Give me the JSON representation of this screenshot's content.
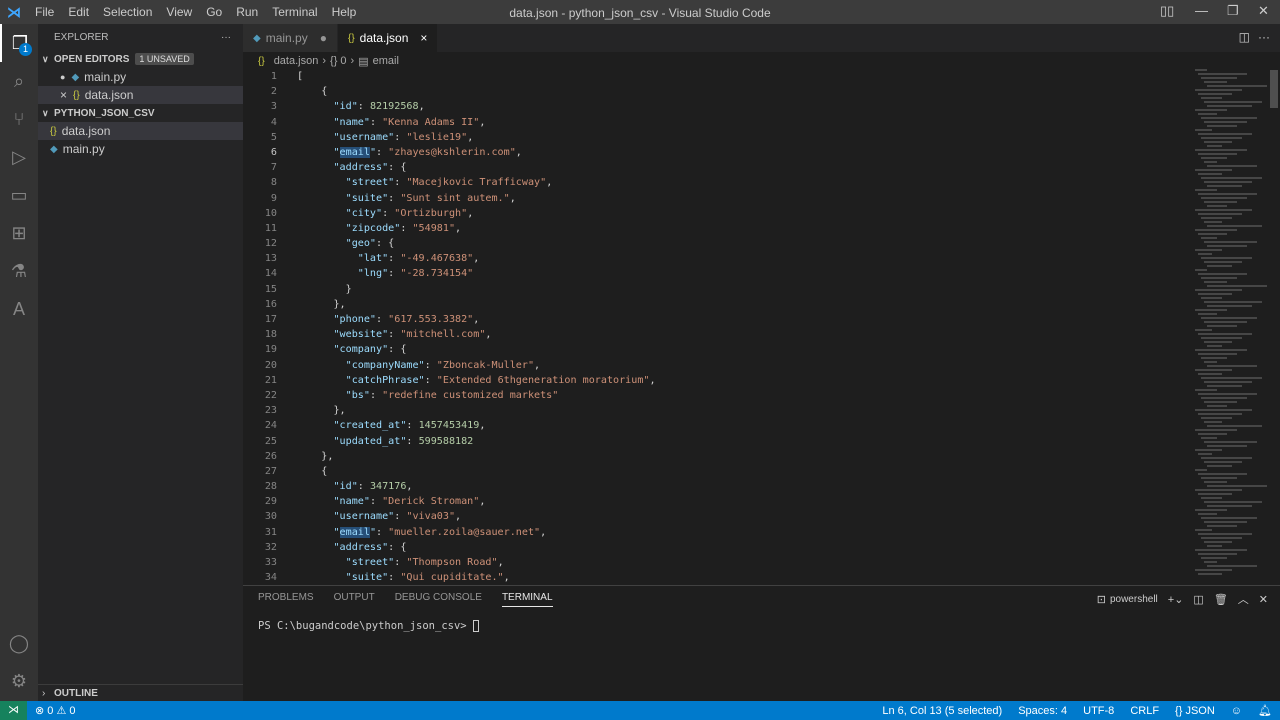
{
  "titlebar": {
    "menu": [
      "File",
      "Edit",
      "Selection",
      "View",
      "Go",
      "Run",
      "Terminal",
      "Help"
    ],
    "title": "data.json - python_json_csv - Visual Studio Code"
  },
  "activity": {
    "explorer_badge": "1"
  },
  "sidebar": {
    "header": "EXPLORER",
    "more": "···",
    "open_editors": "OPEN EDITORS",
    "unsaved": "1 UNSAVED",
    "open_items": [
      {
        "label": "main.py",
        "icon": "python-icon",
        "marker": "●"
      },
      {
        "label": "data.json",
        "icon": "json-icon",
        "marker": "×"
      }
    ],
    "folder": "PYTHON_JSON_CSV",
    "files": [
      {
        "label": "data.json",
        "icon": "json-icon"
      },
      {
        "label": "main.py",
        "icon": "python-icon"
      }
    ],
    "outline": "OUTLINE"
  },
  "tabs": [
    {
      "label": "main.py",
      "icon": "{}",
      "state": "●"
    },
    {
      "label": "data.json",
      "icon": "{}",
      "state": "×"
    }
  ],
  "breadcrumb": [
    "data.json",
    "{} 0",
    "email"
  ],
  "editor": {
    "current_line": 6,
    "lines": [
      [
        [
          "p",
          "["
        ]
      ],
      [
        [
          "p",
          "    {"
        ]
      ],
      [
        [
          "p",
          "      "
        ],
        [
          "k",
          "\"id\""
        ],
        [
          "p",
          ": "
        ],
        [
          "n",
          "82192568"
        ],
        [
          "p",
          ","
        ]
      ],
      [
        [
          "p",
          "      "
        ],
        [
          "k",
          "\"name\""
        ],
        [
          "p",
          ": "
        ],
        [
          "s",
          "\"Kenna Adams II\""
        ],
        [
          "p",
          ","
        ]
      ],
      [
        [
          "p",
          "      "
        ],
        [
          "k",
          "\"username\""
        ],
        [
          "p",
          ": "
        ],
        [
          "s",
          "\"leslie19\""
        ],
        [
          "p",
          ","
        ]
      ],
      [
        [
          "p",
          "      "
        ],
        [
          "k",
          "\""
        ],
        [
          "k hl",
          "email"
        ],
        [
          "k",
          "\""
        ],
        [
          "p",
          ": "
        ],
        [
          "s",
          "\"zhayes@kshlerin.com\""
        ],
        [
          "p",
          ","
        ]
      ],
      [
        [
          "p",
          "      "
        ],
        [
          "k",
          "\"address\""
        ],
        [
          "p",
          ": {"
        ]
      ],
      [
        [
          "p",
          "        "
        ],
        [
          "k",
          "\"street\""
        ],
        [
          "p",
          ": "
        ],
        [
          "s",
          "\"Macejkovic Trafficway\""
        ],
        [
          "p",
          ","
        ]
      ],
      [
        [
          "p",
          "        "
        ],
        [
          "k",
          "\"suite\""
        ],
        [
          "p",
          ": "
        ],
        [
          "s",
          "\"Sunt sint autem.\""
        ],
        [
          "p",
          ","
        ]
      ],
      [
        [
          "p",
          "        "
        ],
        [
          "k",
          "\"city\""
        ],
        [
          "p",
          ": "
        ],
        [
          "s",
          "\"Ortizburgh\""
        ],
        [
          "p",
          ","
        ]
      ],
      [
        [
          "p",
          "        "
        ],
        [
          "k",
          "\"zipcode\""
        ],
        [
          "p",
          ": "
        ],
        [
          "s",
          "\"54981\""
        ],
        [
          "p",
          ","
        ]
      ],
      [
        [
          "p",
          "        "
        ],
        [
          "k",
          "\"geo\""
        ],
        [
          "p",
          ": {"
        ]
      ],
      [
        [
          "p",
          "          "
        ],
        [
          "k",
          "\"lat\""
        ],
        [
          "p",
          ": "
        ],
        [
          "s",
          "\"-49.467638\""
        ],
        [
          "p",
          ","
        ]
      ],
      [
        [
          "p",
          "          "
        ],
        [
          "k",
          "\"lng\""
        ],
        [
          "p",
          ": "
        ],
        [
          "s",
          "\"-28.734154\""
        ]
      ],
      [
        [
          "p",
          "        }"
        ]
      ],
      [
        [
          "p",
          "      },"
        ]
      ],
      [
        [
          "p",
          "      "
        ],
        [
          "k",
          "\"phone\""
        ],
        [
          "p",
          ": "
        ],
        [
          "s",
          "\"617.553.3382\""
        ],
        [
          "p",
          ","
        ]
      ],
      [
        [
          "p",
          "      "
        ],
        [
          "k",
          "\"website\""
        ],
        [
          "p",
          ": "
        ],
        [
          "s",
          "\"mitchell.com\""
        ],
        [
          "p",
          ","
        ]
      ],
      [
        [
          "p",
          "      "
        ],
        [
          "k",
          "\"company\""
        ],
        [
          "p",
          ": {"
        ]
      ],
      [
        [
          "p",
          "        "
        ],
        [
          "k",
          "\"companyName\""
        ],
        [
          "p",
          ": "
        ],
        [
          "s",
          "\"Zboncak-Muller\""
        ],
        [
          "p",
          ","
        ]
      ],
      [
        [
          "p",
          "        "
        ],
        [
          "k",
          "\"catchPhrase\""
        ],
        [
          "p",
          ": "
        ],
        [
          "s",
          "\"Extended 6thgeneration moratorium\""
        ],
        [
          "p",
          ","
        ]
      ],
      [
        [
          "p",
          "        "
        ],
        [
          "k",
          "\"bs\""
        ],
        [
          "p",
          ": "
        ],
        [
          "s",
          "\"redefine customized markets\""
        ]
      ],
      [
        [
          "p",
          "      },"
        ]
      ],
      [
        [
          "p",
          "      "
        ],
        [
          "k",
          "\"created_at\""
        ],
        [
          "p",
          ": "
        ],
        [
          "n",
          "1457453419"
        ],
        [
          "p",
          ","
        ]
      ],
      [
        [
          "p",
          "      "
        ],
        [
          "k",
          "\"updated_at\""
        ],
        [
          "p",
          ": "
        ],
        [
          "n",
          "599588182"
        ]
      ],
      [
        [
          "p",
          "    },"
        ]
      ],
      [
        [
          "p",
          "    {"
        ]
      ],
      [
        [
          "p",
          "      "
        ],
        [
          "k",
          "\"id\""
        ],
        [
          "p",
          ": "
        ],
        [
          "n",
          "347176"
        ],
        [
          "p",
          ","
        ]
      ],
      [
        [
          "p",
          "      "
        ],
        [
          "k",
          "\"name\""
        ],
        [
          "p",
          ": "
        ],
        [
          "s",
          "\"Derick Stroman\""
        ],
        [
          "p",
          ","
        ]
      ],
      [
        [
          "p",
          "      "
        ],
        [
          "k",
          "\"username\""
        ],
        [
          "p",
          ": "
        ],
        [
          "s",
          "\"viva03\""
        ],
        [
          "p",
          ","
        ]
      ],
      [
        [
          "p",
          "      "
        ],
        [
          "k",
          "\""
        ],
        [
          "k hl",
          "email"
        ],
        [
          "k",
          "\""
        ],
        [
          "p",
          ": "
        ],
        [
          "s",
          "\"mueller.zoila@sauer.net\""
        ],
        [
          "p",
          ","
        ]
      ],
      [
        [
          "p",
          "      "
        ],
        [
          "k",
          "\"address\""
        ],
        [
          "p",
          ": {"
        ]
      ],
      [
        [
          "p",
          "        "
        ],
        [
          "k",
          "\"street\""
        ],
        [
          "p",
          ": "
        ],
        [
          "s",
          "\"Thompson Road\""
        ],
        [
          "p",
          ","
        ]
      ],
      [
        [
          "p",
          "        "
        ],
        [
          "k",
          "\"suite\""
        ],
        [
          "p",
          ": "
        ],
        [
          "s",
          "\"Qui cupiditate.\""
        ],
        [
          "p",
          ","
        ]
      ]
    ]
  },
  "panel": {
    "tabs": [
      "PROBLEMS",
      "OUTPUT",
      "DEBUG CONSOLE",
      "TERMINAL"
    ],
    "active": "TERMINAL",
    "shell": "powershell",
    "prompt": "PS C:\\bugandcode\\python_json_csv> "
  },
  "status": {
    "errors": "0",
    "warnings": "0",
    "position": "Ln 6, Col 13 (5 selected)",
    "spaces": "Spaces: 4",
    "encoding": "UTF-8",
    "eol": "CRLF",
    "language": "JSON"
  },
  "colors": {
    "status_bar": "#007acc",
    "editor_bg": "#1e1e1e",
    "key": "#9cdcfe",
    "string": "#ce9178",
    "number": "#b5cea8"
  }
}
